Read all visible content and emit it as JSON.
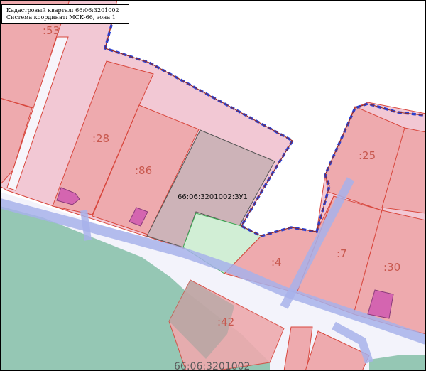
{
  "info": {
    "quarter_line": "Кадастровый квартал: 66:06:3201002",
    "coords_line": "Система координат: МСК-66, зона 1"
  },
  "parcels": {
    "p53": ":53",
    "p28": ":28",
    "p86": ":86",
    "p25": ":25",
    "p4": ":4",
    "p7": ":7",
    "p30": ":30",
    "p42": ":42"
  },
  "target_parcel": "66:06:3201002:ЗУ1",
  "quarter_label": "66:06:3201002",
  "colors": {
    "parcel_fill": "#eeaaae",
    "parcel_stroke": "#d8473d",
    "territory_fill": "#f2c8d4",
    "road_fill": "#b4bcec",
    "water_fill": "#8fc4b0",
    "building_fill": "#d465b0",
    "target_fill": "#cdb3b8",
    "new_parcel_fill": "#d1eed5",
    "boundary_blue": "#2741d8"
  }
}
